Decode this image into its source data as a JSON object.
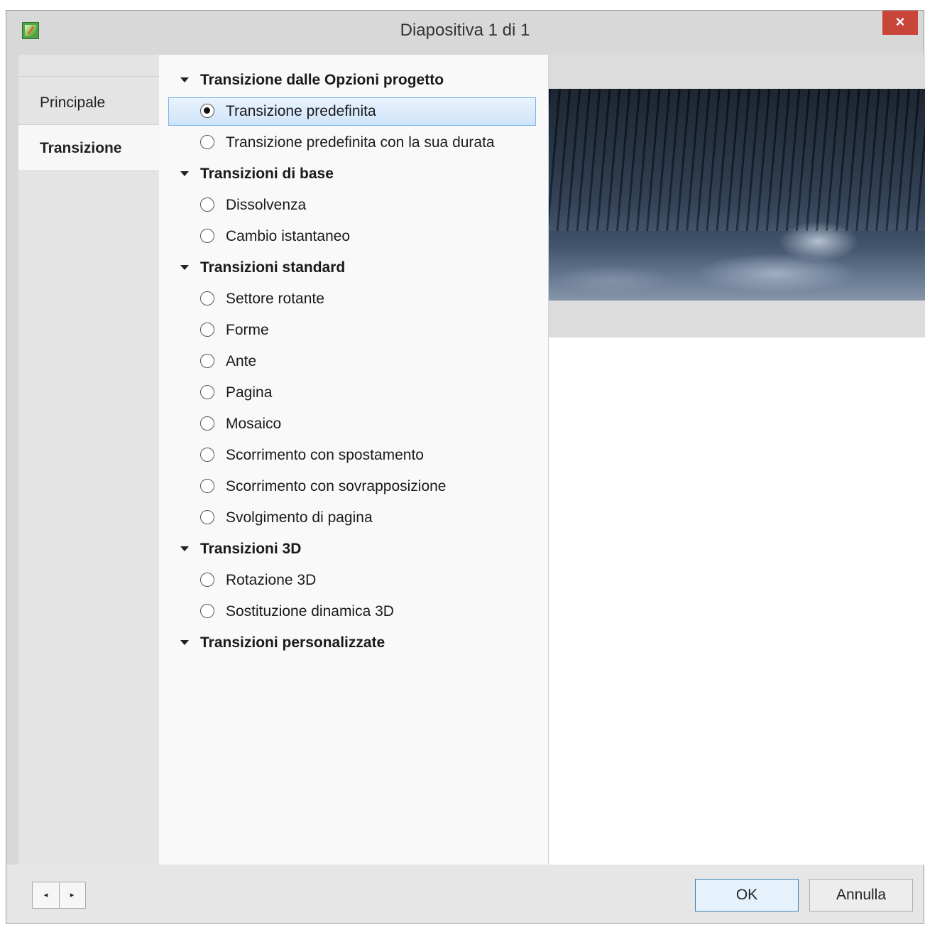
{
  "window": {
    "title": "Diapositiva 1 di 1",
    "close_label": "×"
  },
  "tabs": [
    {
      "label": "Principale",
      "active": false
    },
    {
      "label": "Transizione",
      "active": true
    }
  ],
  "transition_list": {
    "groups": [
      {
        "label": "Transizione dalle Opzioni progetto",
        "options": [
          {
            "label": "Transizione predefinita",
            "checked": true
          },
          {
            "label": "Transizione predefinita con la sua durata",
            "checked": false
          }
        ]
      },
      {
        "label": "Transizioni di base",
        "options": [
          {
            "label": "Dissolvenza",
            "checked": false
          },
          {
            "label": "Cambio istantaneo",
            "checked": false
          }
        ]
      },
      {
        "label": "Transizioni standard",
        "options": [
          {
            "label": "Settore rotante",
            "checked": false
          },
          {
            "label": "Forme",
            "checked": false
          },
          {
            "label": "Ante",
            "checked": false
          },
          {
            "label": "Pagina",
            "checked": false
          },
          {
            "label": "Mosaico",
            "checked": false
          },
          {
            "label": "Scorrimento con spostamento",
            "checked": false
          },
          {
            "label": "Scorrimento con sovrapposizione",
            "checked": false
          },
          {
            "label": "Svolgimento di pagina",
            "checked": false
          }
        ]
      },
      {
        "label": "Transizioni 3D",
        "options": [
          {
            "label": "Rotazione 3D",
            "checked": false
          },
          {
            "label": "Sostituzione dinamica 3D",
            "checked": false
          }
        ]
      },
      {
        "label": "Transizioni personalizzate",
        "options": []
      }
    ]
  },
  "footer": {
    "prev_icon": "◂",
    "next_icon": "▸",
    "ok_label": "OK",
    "cancel_label": "Annulla"
  }
}
